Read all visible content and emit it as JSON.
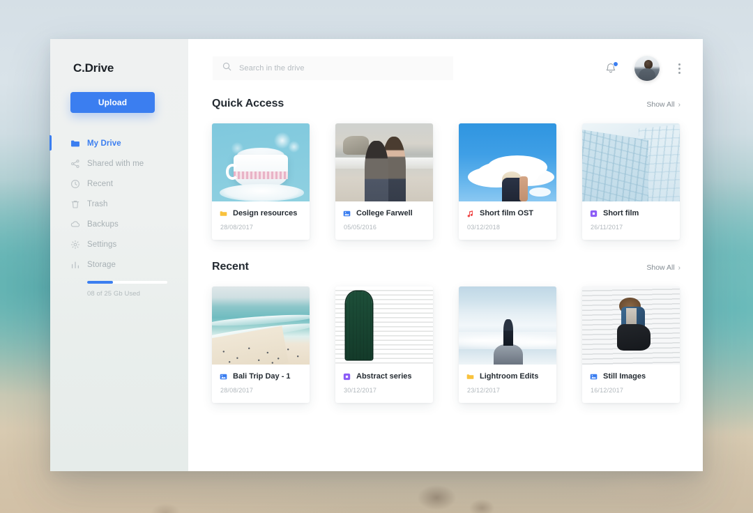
{
  "app": {
    "brand": "C.Drive"
  },
  "sidebar": {
    "upload_label": "Upload",
    "items": [
      {
        "label": "My Drive",
        "icon": "folder-icon",
        "active": true
      },
      {
        "label": "Shared with me",
        "icon": "share-icon",
        "active": false
      },
      {
        "label": "Recent",
        "icon": "clock-icon",
        "active": false
      },
      {
        "label": "Trash",
        "icon": "trash-icon",
        "active": false
      },
      {
        "label": "Backups",
        "icon": "cloud-icon",
        "active": false
      },
      {
        "label": "Settings",
        "icon": "gear-icon",
        "active": false
      },
      {
        "label": "Storage",
        "icon": "chart-icon",
        "active": false
      }
    ],
    "storage": {
      "used_text": "08 of 25 Gb Used",
      "percent": 32,
      "bar_color": "#3b7ef0"
    }
  },
  "topbar": {
    "search_placeholder": "Search in the drive",
    "search_value": "",
    "search_icon": "search-icon",
    "bell_icon": "bell-icon",
    "has_notification": true,
    "menu_icon": "kebab-menu-icon"
  },
  "sections": [
    {
      "title": "Quick Access",
      "show_all_label": "Show All",
      "cards": [
        {
          "title": "Design resources",
          "date": "28/08/2017",
          "ftype": "folder",
          "ftype_color": "#f9c23c",
          "art": "th-teacup"
        },
        {
          "title": "College Farwell",
          "date": "05/05/2016",
          "ftype": "image",
          "ftype_color": "#3b7ef0",
          "art": "th-couple"
        },
        {
          "title": "Short film OST",
          "date": "03/12/2018",
          "ftype": "audio",
          "ftype_color": "#ef4444",
          "art": "th-cloud"
        },
        {
          "title": "Short film",
          "date": "26/11/2017",
          "ftype": "video",
          "ftype_color": "#8b5cf6",
          "art": "th-building"
        }
      ]
    },
    {
      "title": "Recent",
      "show_all_label": "Show All",
      "cards": [
        {
          "title": "Bali Trip Day - 1",
          "date": "28/08/2017",
          "ftype": "image",
          "ftype_color": "#3b7ef0",
          "art": "th-beach"
        },
        {
          "title": "Abstract series",
          "date": "30/12/2017",
          "ftype": "video",
          "ftype_color": "#8b5cf6",
          "art": "th-door"
        },
        {
          "title": "Lightroom Edits",
          "date": "23/12/2017",
          "ftype": "folder",
          "ftype_color": "#f9c23c",
          "art": "th-clouds2"
        },
        {
          "title": "Still Images",
          "date": "16/12/2017",
          "ftype": "image",
          "ftype_color": "#3b7ef0",
          "art": "th-jump"
        }
      ]
    }
  ]
}
